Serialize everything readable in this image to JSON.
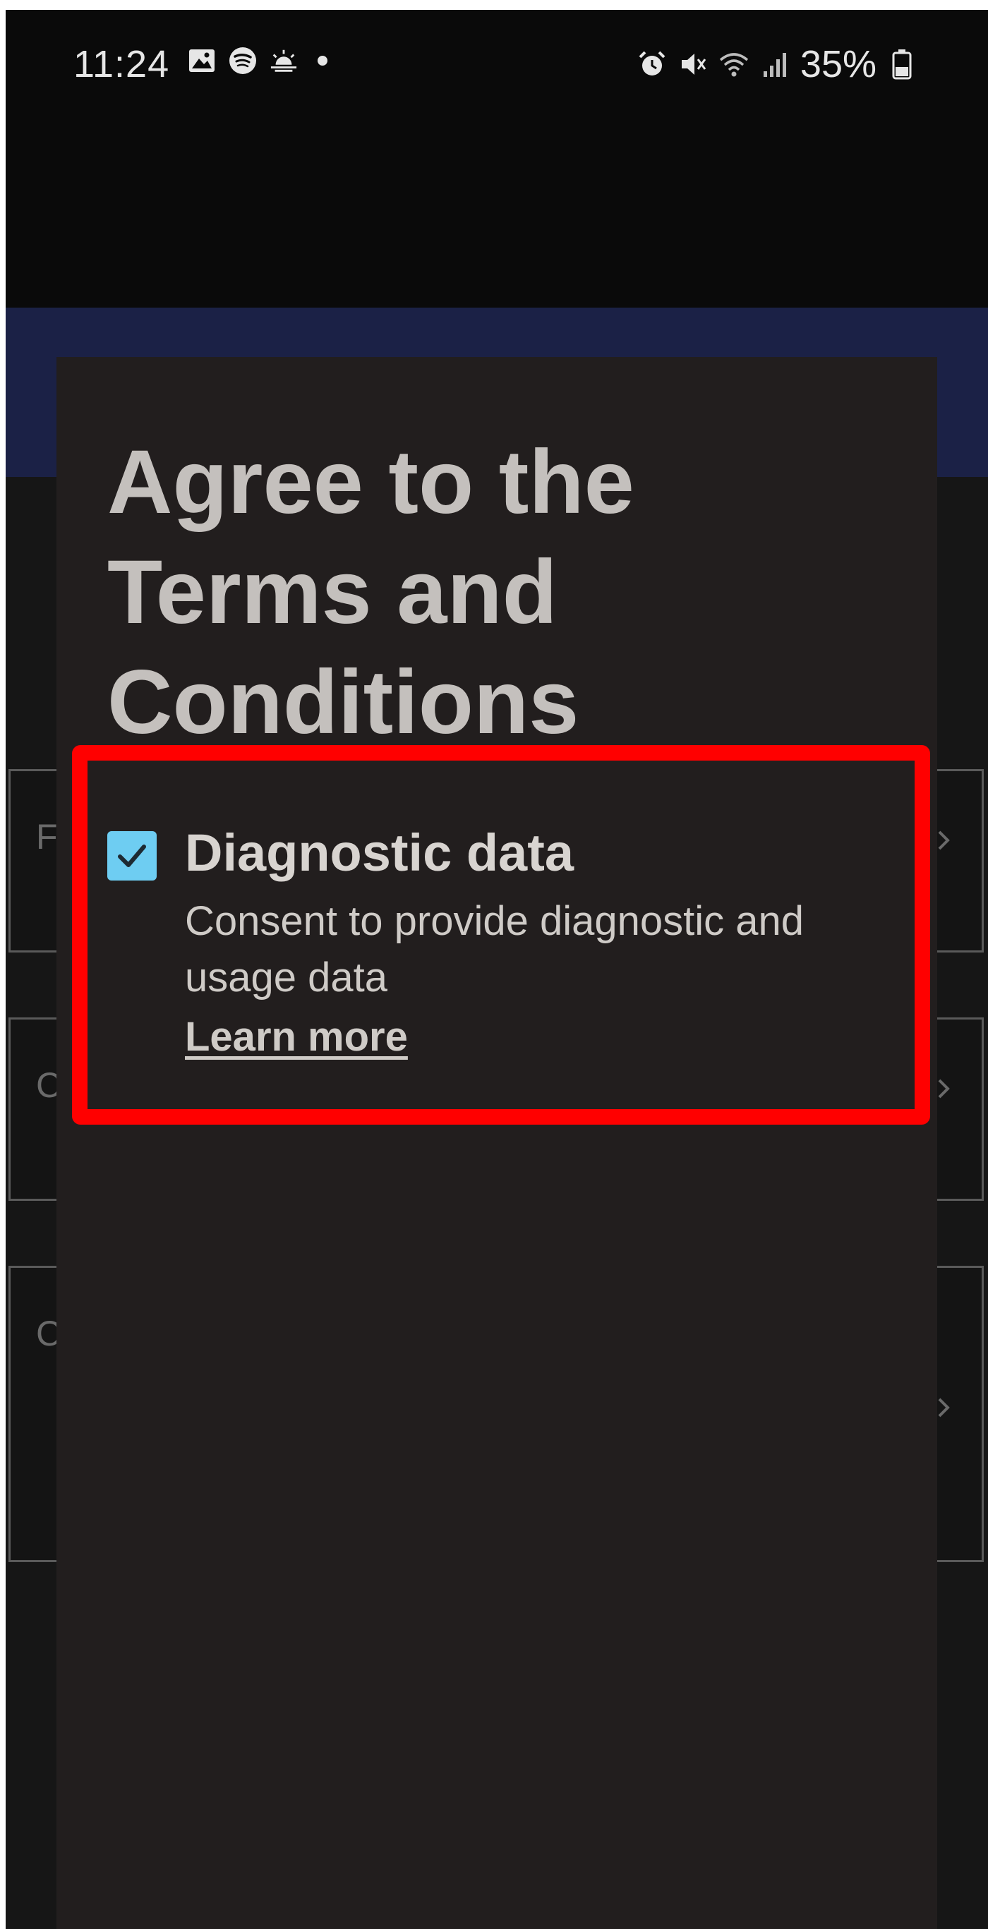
{
  "status_bar": {
    "time": "11:24",
    "left_icons": [
      "gallery-icon",
      "spotify-icon",
      "weather-icon"
    ],
    "right_icons": [
      "alarm-icon",
      "mute-icon",
      "wifi-icon",
      "signal-icon"
    ],
    "battery": "35%"
  },
  "dialog": {
    "title": "Agree to the Terms and Conditions",
    "consent": {
      "checked": true,
      "title": "Diagnostic data",
      "description": "Consent to provide diagnostic and usage data",
      "link": "Learn more"
    }
  },
  "background_fields": {
    "letters": [
      "F",
      "C",
      "C"
    ]
  },
  "colors": {
    "dialog_bg": "#221e1e",
    "header_bg": "#1b2146",
    "checkbox": "#6ecdf2",
    "highlight": "#ff0000",
    "title_text": "#c4c0bd"
  }
}
